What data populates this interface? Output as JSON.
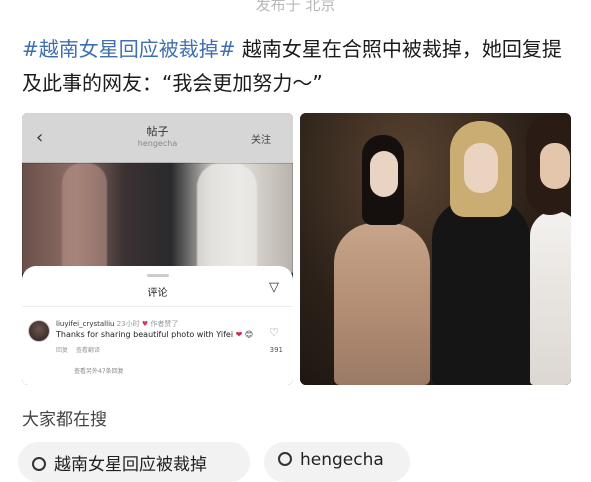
{
  "top_meta": "发布于 北京",
  "post": {
    "tag": "#越南女星回应被裁掉#",
    "text": " 越南女星在合照中被裁掉，她回复提及此事的网友：“我会更加努力～”"
  },
  "screenshot": {
    "header_title": "帖子",
    "header_sub": "hengecha",
    "follow_label": "关注",
    "comments_title": "评论",
    "comment": {
      "username": "liuyifei_crystalliu",
      "time": "23小时",
      "author_liked": "作者赞了",
      "text": "Thanks for sharing beautiful photo with Yifei",
      "heart": "❤",
      "emoji": "😊",
      "reply": "回复",
      "translate": "查看翻译",
      "likes": "391",
      "more_replies": "查看另外47条回复"
    }
  },
  "search_section": {
    "title": "大家都在搜",
    "chips": [
      "越南女星回应被裁掉",
      "hengecha"
    ]
  },
  "icons": {
    "back": "chevron-left-icon",
    "send": "send-icon",
    "like": "heart-outline-icon",
    "search": "search-icon"
  },
  "colors": {
    "tag": "#3f6fb0",
    "heart": "#d9234a"
  }
}
